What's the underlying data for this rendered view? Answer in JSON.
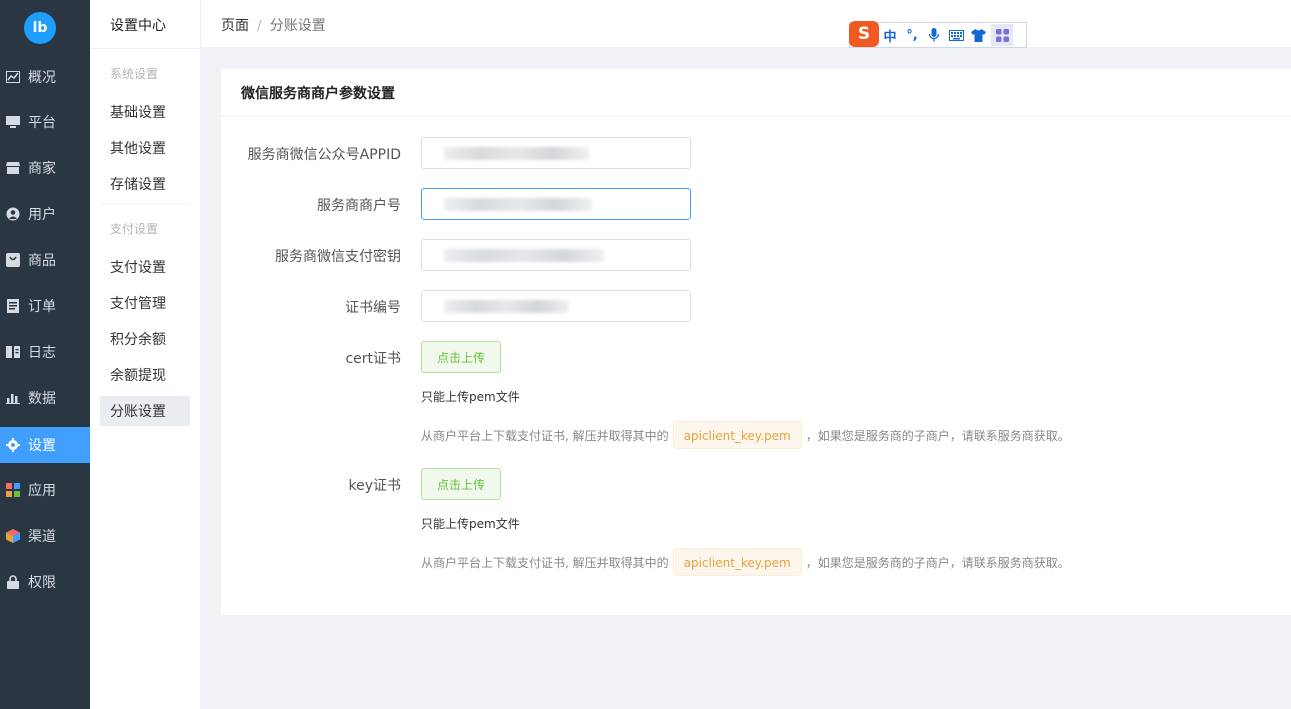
{
  "nav": {
    "logo": "lb",
    "items": [
      {
        "label": "概况",
        "icon": "chart-icon"
      },
      {
        "label": "平台",
        "icon": "monitor-icon"
      },
      {
        "label": "商家",
        "icon": "store-icon"
      },
      {
        "label": "用户",
        "icon": "user-icon"
      },
      {
        "label": "商品",
        "icon": "goods-icon"
      },
      {
        "label": "订单",
        "icon": "order-icon"
      },
      {
        "label": "日志",
        "icon": "log-icon"
      },
      {
        "label": "数据",
        "icon": "bar-chart-icon"
      },
      {
        "label": "设置",
        "icon": "gear-icon",
        "active": true
      },
      {
        "label": "应用",
        "icon": "apps-icon"
      },
      {
        "label": "渠道",
        "icon": "cube-icon"
      },
      {
        "label": "权限",
        "icon": "lock-icon"
      }
    ]
  },
  "submenu": {
    "title": "设置中心",
    "group1": "系统设置",
    "items1": [
      "基础设置",
      "其他设置",
      "存储设置"
    ],
    "group2": "支付设置",
    "items2": [
      "支付设置",
      "支付管理",
      "积分余额",
      "余额提现",
      "分账设置"
    ]
  },
  "breadcrumb": {
    "root": "页面",
    "separator": "/",
    "current": "分账设置"
  },
  "ime": {
    "logo": "S",
    "lang": "中",
    "punct": "°,"
  },
  "panel": {
    "title": "微信服务商商户参数设置",
    "fields": [
      {
        "label": "服务商微信公众号APPID"
      },
      {
        "label": "服务商商户号"
      },
      {
        "label": "服务商微信支付密钥"
      },
      {
        "label": "证书编号"
      }
    ],
    "cert": {
      "label": "cert证书",
      "button": "点击上传",
      "hint": "只能上传pem文件",
      "note_before": "从商户平台上下载支付证书, 解压并取得其中的",
      "tag": "apiclient_key.pem",
      "note_after": "，如果您是服务商的子商户，请联系服务商获取。"
    },
    "key": {
      "label": "key证书",
      "button": "点击上传",
      "hint": "只能上传pem文件",
      "note_before": "从商户平台上下载支付证书, 解压并取得其中的",
      "tag": "apiclient_key.pem",
      "note_after": "，如果您是服务商的子商户，请联系服务商获取。"
    }
  },
  "colors": {
    "sidebar": "#2b3643",
    "active": "#409eff",
    "upload": "#67c23a",
    "tag": "#e6a23c"
  }
}
